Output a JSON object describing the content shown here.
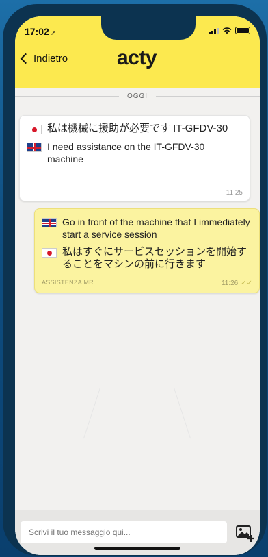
{
  "status_bar": {
    "time": "17:02",
    "icons": [
      "location-arrow-icon",
      "signal-icon",
      "wifi-icon",
      "battery-icon"
    ]
  },
  "header": {
    "back_label": "Indietro",
    "logo_text": "acty",
    "background_color": "#fce94f"
  },
  "chat": {
    "day_separator": "OGGI",
    "messages": [
      {
        "direction": "incoming",
        "lines": [
          {
            "flag": "japan-flag-icon",
            "text": "私は機械に援助が必要です IT-GFDV-30"
          },
          {
            "flag": "uk-flag-icon",
            "text": "I need assistance on the IT-GFDV-30 machine"
          }
        ],
        "sender": "",
        "time": "11:25"
      },
      {
        "direction": "outgoing",
        "lines": [
          {
            "flag": "uk-flag-icon",
            "text": "Go in front of the machine that I immediately start a service session"
          },
          {
            "flag": "japan-flag-icon",
            "text": "私はすぐにサービスセッションを開始することをマシンの前に行きます"
          }
        ],
        "sender": "ASSISTENZA MR",
        "time": "11:26",
        "status": "double-check-icon"
      }
    ]
  },
  "composer": {
    "placeholder": "Scrivi il tuo messaggio qui...",
    "attach_icon": "add-image-icon"
  }
}
